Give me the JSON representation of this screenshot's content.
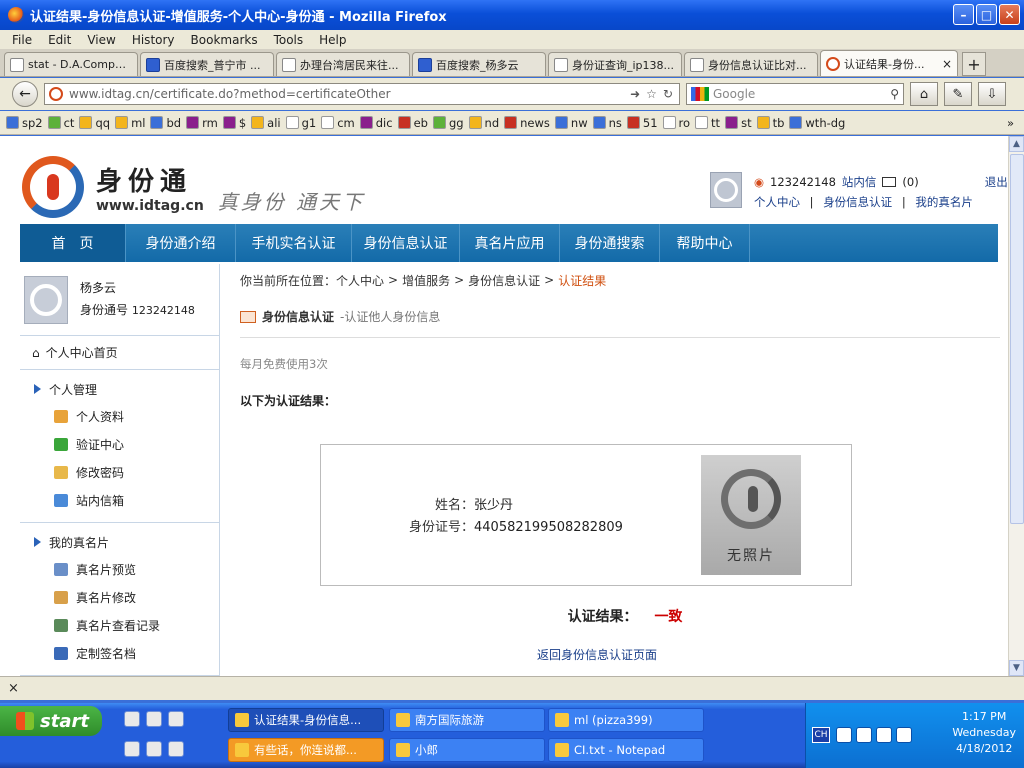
{
  "window": {
    "title": "认证结果-身份信息认证-增值服务-个人中心-身份通 - Mozilla Firefox"
  },
  "menu": [
    "File",
    "Edit",
    "View",
    "History",
    "Bookmarks",
    "Tools",
    "Help"
  ],
  "tabs": [
    {
      "label": "stat - D.A.Comput...",
      "icon": "stat"
    },
    {
      "label": "百度搜索_普宁市 ...",
      "icon": "baidu"
    },
    {
      "label": "办理台湾居民来往...",
      "icon": "page"
    },
    {
      "label": "百度搜索_杨多云",
      "icon": "baidu"
    },
    {
      "label": "身份证查询_ip138...",
      "icon": "page"
    },
    {
      "label": "身份信息认证比对...",
      "icon": "page"
    },
    {
      "label": "认证结果-身份...",
      "icon": "idtag"
    }
  ],
  "url": "www.idtag.cn/certificate.do?method=certificateOther",
  "search": {
    "placeholder": "Google"
  },
  "bookmarks": [
    "sp2",
    "ct",
    "qq",
    "ml",
    "bd",
    "rm",
    "$",
    "ali",
    "g1",
    "cm",
    "dic",
    "eb",
    "gg",
    "nd",
    "news",
    "nw",
    "ns",
    "51",
    "ro",
    "tt",
    "st",
    "tb",
    "wth-dg"
  ],
  "bookmarks_more": "»",
  "site": {
    "logo_cn": "身份通",
    "logo_url": "www.idtag.cn",
    "slogan": "真身份 通天下",
    "user_id": "123242148",
    "inbox_label": "站内信",
    "inbox_count": "(0)",
    "logout": "退出",
    "user_links": [
      "个人中心",
      "|",
      "身份信息认证",
      "|",
      "我的真名片"
    ],
    "nav": [
      "首　页",
      "身份通介绍",
      "手机实名认证",
      "身份信息认证",
      "真名片应用",
      "身份通搜索",
      "帮助中心"
    ]
  },
  "sidebar": {
    "name": "杨多云",
    "id_label": "身份通号",
    "id_value": "123242148",
    "home": "个人中心首页",
    "sections": [
      {
        "title": "个人管理",
        "items": [
          "个人资料",
          "验证中心",
          "修改密码",
          "站内信箱"
        ]
      },
      {
        "title": "我的真名片",
        "items": [
          "真名片预览",
          "真名片修改",
          "真名片查看记录",
          "定制签名档"
        ]
      }
    ]
  },
  "main": {
    "breadcrumb": [
      "你当前所在位置：个人中心",
      ">",
      "增值服务",
      ">",
      "身份信息认证",
      ">",
      "认证结果"
    ],
    "heading": "身份信息认证",
    "subheading": "-认证他人身份信息",
    "quota": "每月免费使用3次",
    "result_intro": "以下为认证结果：",
    "name_label": "姓名：",
    "name_value": "张少丹",
    "idno_label": "身份证号：",
    "idno_value": "440582199508282809",
    "no_photo": "无照片",
    "result_label": "认证结果：",
    "result_value": "一致",
    "back_link": "返回身份信息认证页面"
  },
  "statusbar": {
    "close": "×"
  },
  "taskbar": {
    "start": "start",
    "buttons_row1": [
      "认证结果-身份信息...",
      "南方国际旅游",
      "ml (pizza399)"
    ],
    "buttons_row2": [
      "有些话，你连说都...",
      "小郎",
      "CI.txt - Notepad"
    ],
    "lang": "CH",
    "time": "1:17 PM",
    "day": "Wednesday",
    "date": "4/18/2012"
  },
  "colors": {
    "nav_blue": "#136aa8",
    "result_red": "#cc0000",
    "crumb_orange": "#d05010"
  }
}
